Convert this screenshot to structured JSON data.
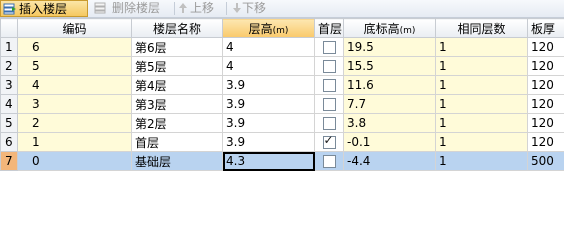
{
  "toolbar": {
    "insert_label": "插入楼层",
    "delete_label": "删除楼层",
    "up_label": "上移",
    "down_label": "下移"
  },
  "columns": [
    {
      "label": "编码",
      "unit": ""
    },
    {
      "label": "楼层名称",
      "unit": ""
    },
    {
      "label": "层高",
      "unit": "(m)"
    },
    {
      "label": "首层",
      "unit": ""
    },
    {
      "label": "底标高",
      "unit": "(m)"
    },
    {
      "label": "相同层数",
      "unit": ""
    },
    {
      "label": "板厚",
      "unit": ""
    }
  ],
  "rows": [
    {
      "num": "1",
      "code": "6",
      "name": "第6层",
      "height": "4",
      "first": false,
      "elev": "19.5",
      "same": "1",
      "slab": "120"
    },
    {
      "num": "2",
      "code": "5",
      "name": "第5层",
      "height": "4",
      "first": false,
      "elev": "15.5",
      "same": "1",
      "slab": "120"
    },
    {
      "num": "3",
      "code": "4",
      "name": "第4层",
      "height": "3.9",
      "first": false,
      "elev": "11.6",
      "same": "1",
      "slab": "120"
    },
    {
      "num": "4",
      "code": "3",
      "name": "第3层",
      "height": "3.9",
      "first": false,
      "elev": "7.7",
      "same": "1",
      "slab": "120"
    },
    {
      "num": "5",
      "code": "2",
      "name": "第2层",
      "height": "3.9",
      "first": false,
      "elev": "3.8",
      "same": "1",
      "slab": "120"
    },
    {
      "num": "6",
      "code": "1",
      "name": "首层",
      "height": "3.9",
      "first": true,
      "elev": "-0.1",
      "same": "1",
      "slab": "120"
    },
    {
      "num": "7",
      "code": "0",
      "name": "基础层",
      "height": "4.3",
      "first": false,
      "elev": "-4.4",
      "same": "1",
      "slab": "500"
    }
  ]
}
